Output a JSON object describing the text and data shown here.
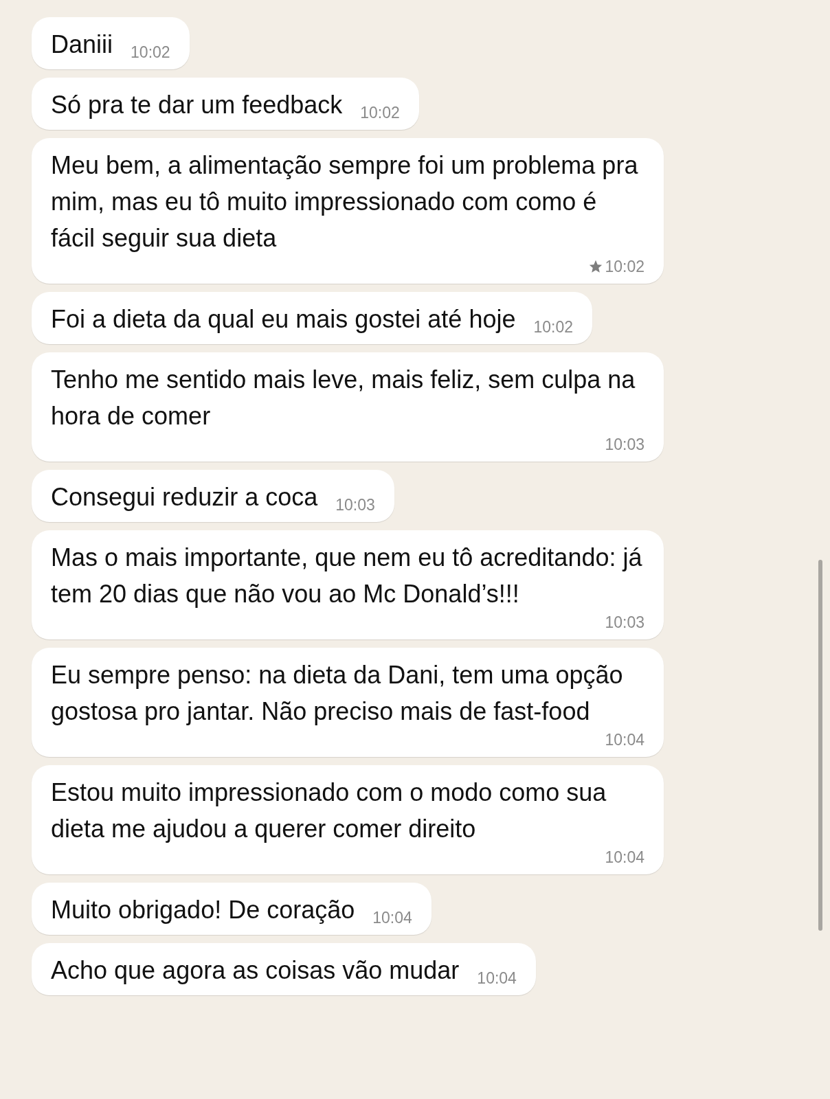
{
  "messages": [
    {
      "text": "Daniii",
      "time": "10:02",
      "starred": false
    },
    {
      "text": "Só pra te dar um feedback",
      "time": "10:02",
      "starred": false
    },
    {
      "text": "Meu bem, a alimentação sempre foi um problema pra mim, mas eu tô muito impressionado com como é fácil seguir sua dieta",
      "time": "10:02",
      "starred": true
    },
    {
      "text": "Foi a dieta da qual eu mais gostei até hoje",
      "time": "10:02",
      "starred": false
    },
    {
      "text": "Tenho me sentido mais leve, mais feliz, sem culpa na hora de comer",
      "time": "10:03",
      "starred": false
    },
    {
      "text": "Consegui reduzir a coca",
      "time": "10:03",
      "starred": false
    },
    {
      "text": "Mas o mais importante, que nem eu tô acreditando: já tem 20 dias que não vou ao Mc Donald’s!!!",
      "time": "10:03",
      "starred": false
    },
    {
      "text": "Eu sempre penso: na dieta da Dani, tem uma opção gostosa pro jantar. Não preciso mais de fast-food",
      "time": "10:04",
      "starred": false
    },
    {
      "text": "Estou muito impressionado com o modo como sua dieta me ajudou a querer comer direito",
      "time": "10:04",
      "starred": false
    },
    {
      "text": "Muito obrigado! De coração",
      "time": "10:04",
      "starred": false
    },
    {
      "text": "Acho que agora as coisas vão mudar",
      "time": "10:04",
      "starred": false
    }
  ]
}
